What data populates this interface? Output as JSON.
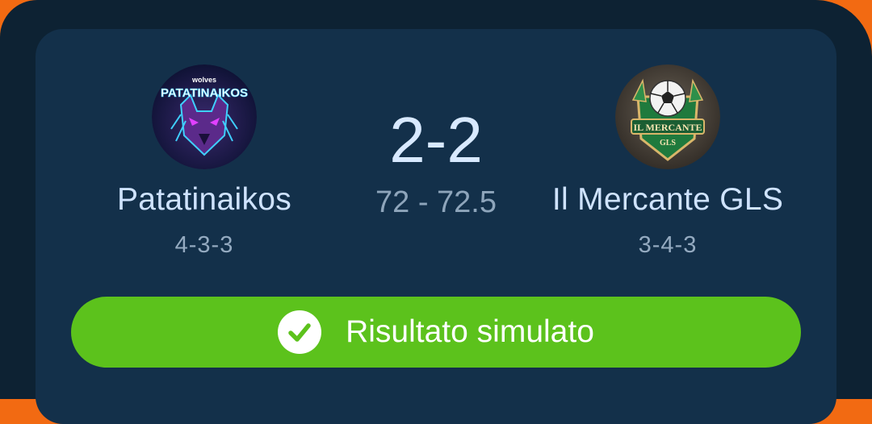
{
  "match": {
    "home": {
      "name": "Patatinaikos",
      "formation": "4-3-3",
      "logo_icon": "wolf-crest-icon",
      "logo_text_top": "wolves",
      "logo_text_main": "PATATINAIKOS"
    },
    "away": {
      "name": "Il Mercante GLS",
      "formation": "3-4-3",
      "logo_icon": "soccer-ball-shield-crest-icon",
      "logo_text_main": "IL MERCANTE",
      "logo_text_sub": "GLS"
    },
    "score": "2-2",
    "points": "72 - 72.5"
  },
  "result": {
    "label": "Risultato simulato",
    "icon": "check-circle-icon",
    "color": "#5cc21c"
  },
  "colors": {
    "background": "#0d2233",
    "card": "#13304a",
    "accent_orange": "#f26a12"
  }
}
